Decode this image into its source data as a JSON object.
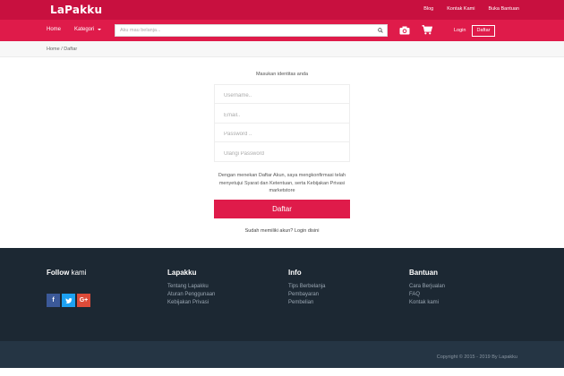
{
  "header": {
    "logo": "LaPakku",
    "top_links": [
      "Blog",
      "Kontak Kami",
      "Buka Bantuan"
    ]
  },
  "nav": {
    "home": "Home",
    "kategori": "Kategori",
    "search_placeholder": "Aku mau belanja...",
    "login": "Login",
    "daftar": "Daftar"
  },
  "breadcrumb": "Home / Daftar",
  "form": {
    "title": "Masukan identitas anda",
    "username_placeholder": "Username..",
    "email_placeholder": "Email..",
    "password_placeholder": "Password ..",
    "repeat_password_placeholder": "Ulangi Password",
    "terms": "Dengan menekan Daftar Akun, saya mengkonfirmasi telah menyetujui Syarat dan Ketentuan, serta Kebijakan Privasi marketstore",
    "submit": "Daftar",
    "login_link": "Sudah memiliki akun? Login disini"
  },
  "footer": {
    "follow_bold": "Follow",
    "follow_rest": "kami",
    "social": [
      "f",
      "t",
      "G+"
    ],
    "columns": [
      {
        "title": "Lapakku",
        "links": [
          "Tentang Lapakku",
          "Aturan Penggunaan",
          "Kebijakan Privasi"
        ]
      },
      {
        "title": "Info",
        "links": [
          "Tips Berbelanja",
          "Pembayaran",
          "Pembelian"
        ]
      },
      {
        "title": "Bantuan",
        "links": [
          "Cara Berjualan",
          "FAQ",
          "Kontak kami"
        ]
      }
    ],
    "copyright": "Copyright © 2015 - 2019 By Lapakku"
  },
  "colors": {
    "topbar": "#c8103f",
    "navbar": "#df1b4a",
    "button": "#df1b4a",
    "footer": "#1c2833",
    "footer_bottom": "#253544"
  }
}
